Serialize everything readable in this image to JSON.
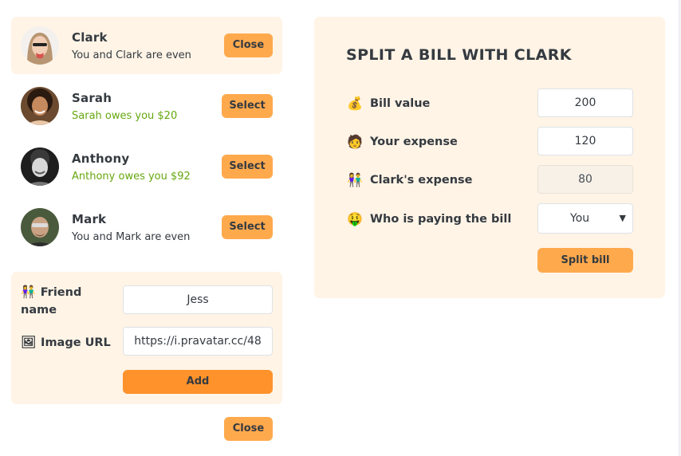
{
  "friends": [
    {
      "name": "Clark",
      "status": "You and Clark are even",
      "status_tone": "neutral",
      "button": "Close",
      "selected": true
    },
    {
      "name": "Sarah",
      "status": "Sarah owes you $20",
      "status_tone": "positive",
      "button": "Select",
      "selected": false
    },
    {
      "name": "Anthony",
      "status": "Anthony owes you $92",
      "status_tone": "positive",
      "button": "Select",
      "selected": false
    },
    {
      "name": "Mark",
      "status": "You and Mark are even",
      "status_tone": "neutral",
      "button": "Select",
      "selected": false
    }
  ],
  "add_friend": {
    "name_label": "Friend name",
    "name_icon": "people-icon",
    "name_value": "Jess",
    "image_label": "Image URL",
    "image_icon": "picture-icon",
    "image_value": "https://i.pravatar.cc/48",
    "add_button": "Add"
  },
  "bottom_close_button": "Close",
  "split": {
    "title": "SPLIT A BILL WITH CLARK",
    "bill_label": "Bill value",
    "bill_icon": "money-bag-icon",
    "bill_value": "200",
    "your_label": "Your expense",
    "your_icon": "person-icon",
    "your_value": "120",
    "friend_label": "Clark's expense",
    "friend_icon": "people-icon",
    "friend_value": "80",
    "payer_label": "Who is paying the bill",
    "payer_icon": "money-face-icon",
    "payer_value": "You",
    "split_button": "Split bill"
  },
  "colors": {
    "panel_bg": "#fff4e6",
    "button": "#ffa94d",
    "button_strong": "#ff922b",
    "positive_text": "#66a80f"
  }
}
